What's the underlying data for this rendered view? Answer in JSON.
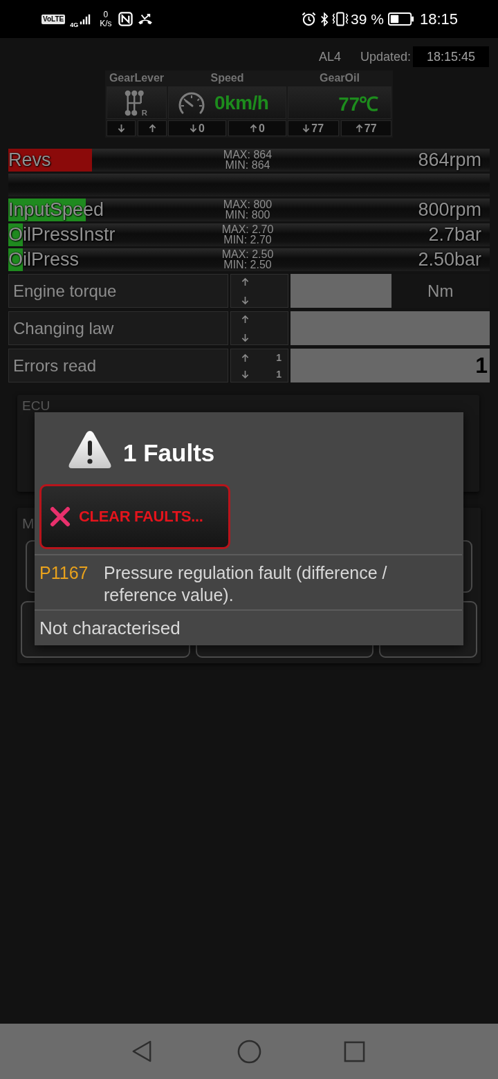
{
  "status_bar": {
    "volte": "VoLTE",
    "network": "4G",
    "rate_value": "0",
    "rate_unit": "K/s",
    "battery_percent": "39 %",
    "time": "18:15"
  },
  "header": {
    "model": "AL4",
    "updated_label": "Updated:",
    "updated_time": "18:15:45"
  },
  "gauges": [
    {
      "kind": "gear",
      "label": "GearLever",
      "icon_letter": "R"
    },
    {
      "kind": "speed",
      "label": "Speed",
      "value": "0km/h",
      "low": "0",
      "high": "0"
    },
    {
      "kind": "plain",
      "label": "GearOil",
      "value": "77℃",
      "low": "77",
      "high": "77"
    }
  ],
  "meters": [
    {
      "kind": "meter",
      "label": "Revs",
      "max": "MAX: 864",
      "min": "MIN: 864",
      "value": "864rpm",
      "level": 0.174,
      "color": "#8b0a0a"
    },
    {
      "kind": "blank"
    },
    {
      "kind": "meter",
      "label": "InputSpeed",
      "max": "MAX: 800",
      "min": "MIN: 800",
      "value": "800rpm",
      "level": 0.161,
      "color": "#1f8a1f"
    },
    {
      "kind": "meter",
      "label": "OilPressInstr",
      "max": "MAX: 2.70",
      "min": "MIN: 2.70",
      "value": "2.7bar",
      "level": 0.03,
      "color": "#1f8a1f"
    },
    {
      "kind": "meter",
      "label": "OilPress",
      "max": "MAX: 2.50",
      "min": "MIN: 2.50",
      "value": "2.50bar",
      "level": 0.03,
      "color": "#1f8a1f"
    }
  ],
  "readings": [
    {
      "label": "Engine torque",
      "unit": "Nm"
    },
    {
      "label": "Changing law"
    },
    {
      "label": "Errors read",
      "up": "1",
      "down": "1",
      "value": "1"
    }
  ],
  "panels": [
    {
      "title": "ECU",
      "kind": "plain"
    },
    {
      "title": "M",
      "kind": "buttons"
    }
  ],
  "dialog": {
    "title": "1 Faults",
    "clear_button": "CLEAR FAULTS...",
    "faults": [
      {
        "code": "P1167",
        "description": "Pressure regulation fault (difference / reference value)."
      }
    ],
    "footer": "Not characterised"
  }
}
